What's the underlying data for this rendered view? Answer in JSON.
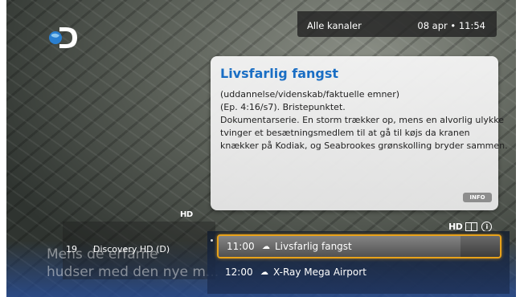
{
  "header": {
    "filter_label": "Alle kanaler",
    "datetime": "08 apr • 11:54"
  },
  "info_panel": {
    "title": "Livsfarlig fangst",
    "lines": [
      "(uddannelse/videnskab/faktuelle emner)",
      "(Ep. 4:16/s7).  Bristepunktet.",
      "Dokumentarserie. En storm trækker op, mens en alvorlig ulykke",
      "tvinger et besætningsmedlem til at gå til køjs da kranen",
      "knækker på Kodiak, og Seabrookes grønskolling bryder sammen."
    ],
    "info_button": "INFO"
  },
  "badges": {
    "hd_left": "HD",
    "hd_right": "HD",
    "info_icon": "i"
  },
  "channel": {
    "number": "19",
    "name": "Discovery HD (D)"
  },
  "subtitle": {
    "line1": "Mens de erfarne",
    "line2": "hudser med den nye m..."
  },
  "programs": [
    {
      "time": "11:00",
      "category_icon": "cloud-icon",
      "title": "Livsfarlig fangst",
      "selected": true,
      "progress": 0.86
    },
    {
      "time": "12:00",
      "category_icon": "cloud-icon",
      "title": "X-Ray Mega Airport",
      "selected": false
    }
  ],
  "colors": {
    "accent_title": "#1a6ec4",
    "selection_border": "#e8a21a"
  }
}
